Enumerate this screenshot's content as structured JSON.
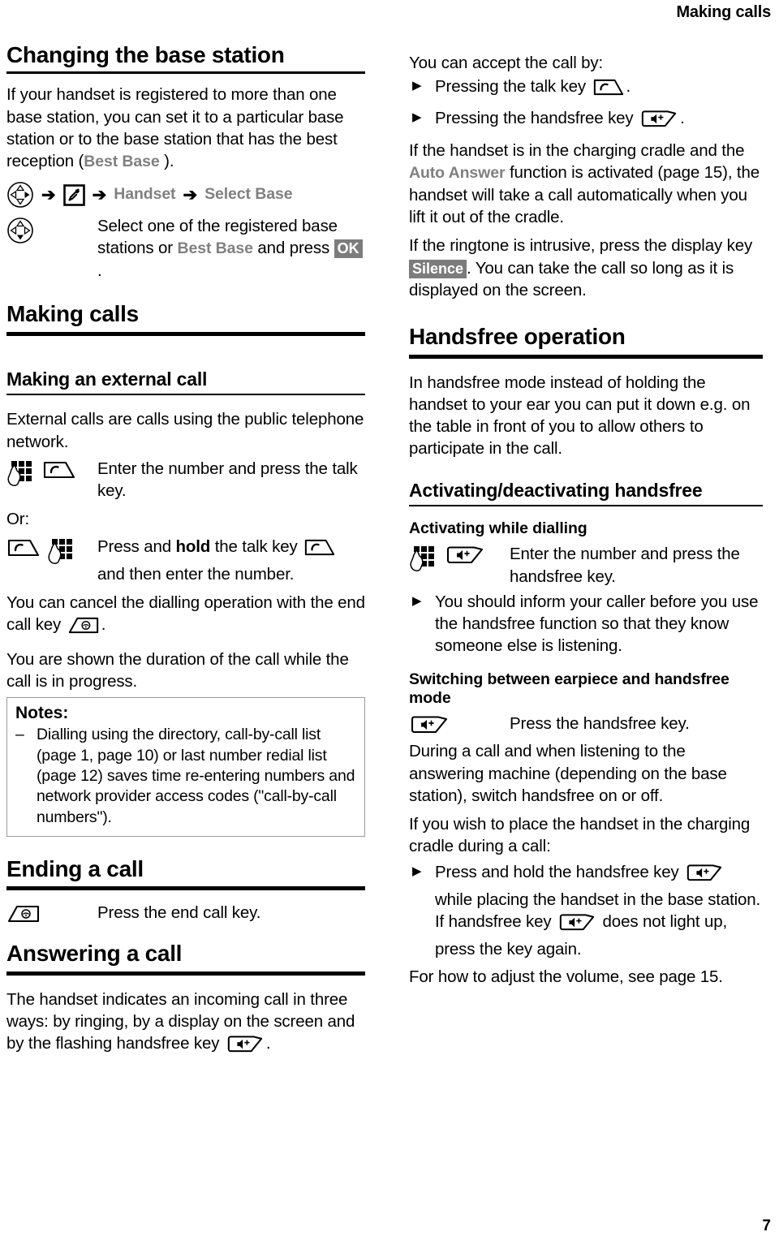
{
  "page": {
    "running_head": "Making calls",
    "folio": "7"
  },
  "left": {
    "h_changing_base": "Changing the base station",
    "p_intro_1": "If your handset is registered to more than one base station, you can set it to a particular base station or to the base station that has the best reception (",
    "p_intro_best_base": "Best Base",
    "p_intro_2": " ).",
    "menu_path": {
      "nav_icon": "navigation-key-right-icon",
      "arrow": "➔",
      "settings_icon": "wrench-menu-icon",
      "item_handset": "Handset",
      "item_select_base": "Select Base"
    },
    "select_step": {
      "nav_icon": "navigation-key-down-icon",
      "text_1": "Select one of the registered base stations or ",
      "term_best_base": "Best Base",
      "text_2": " and press ",
      "key_ok": "OK",
      "text_3": "."
    },
    "h_making_calls": "Making calls",
    "h_making_external": "Making an external call",
    "p_external": "External calls are calls using the public telephone network.",
    "proc_enter_number": {
      "icon_keypad": "keypad-hand-icon",
      "icon_talk": "talk-key-icon",
      "text": "Enter the number and press the talk key."
    },
    "or_label": "Or:",
    "proc_hold_talk": {
      "icon_talk": "talk-key-icon",
      "icon_keypad": "keypad-hand-icon",
      "text_1": "Press and ",
      "bold_hold": "hold",
      "text_2": " the talk key ",
      "icon_inline_talk": "talk-key-icon",
      "text_3": " and then enter the number."
    },
    "p_cancel_1": "You can cancel the dialling operation with the end call key ",
    "p_cancel_icon": "end-call-key-icon",
    "p_cancel_2": ".",
    "p_duration": "You are shown the duration of the call while the call is in progress.",
    "notes": {
      "title": "Notes:",
      "dash": "–",
      "items": [
        "Dialling using the directory, call-by-call list (page 1, page 10) or last number redial list (page 12) saves time re-entering numbers and network provider access codes (\"call-by-call numbers\")."
      ]
    },
    "h_ending_call": "Ending a call",
    "proc_end_call": {
      "icon_end": "end-call-key-icon",
      "text": "Press the end call key."
    },
    "h_answering_call": "Answering a call",
    "p_answering_1": "The handset indicates an incoming call in three ways: by ringing, by a display on the screen and by the flashing handsfree key ",
    "p_answering_icon": "handsfree-key-icon",
    "p_answering_2": "."
  },
  "right": {
    "p_accept": "You can accept the call by:",
    "bullets_accept": [
      {
        "mark": "▶",
        "text_1": "Pressing the talk key ",
        "icon": "talk-key-icon",
        "text_2": "."
      },
      {
        "mark": "▶",
        "text_1": "Pressing the handsfree key ",
        "icon": "handsfree-key-icon",
        "text_2": "."
      }
    ],
    "p_cradle_1": "If the handset is in the charging cradle and the ",
    "p_cradle_term": "Auto Answer",
    "p_cradle_2": " function is activated (page 15), the handset will take a call automatically when you lift it out of the cradle.",
    "p_ringtone_1": "If the ringtone is intrusive, press the display key ",
    "p_ringtone_key": "Silence",
    "p_ringtone_2": ". You can take the call so long as it is displayed on the screen.",
    "h_handsfree_operation": "Handsfree operation",
    "p_handsfree_mode": "In handsfree mode instead of holding the handset to your ear you can put it down e.g. on the table in front of you to allow others to participate in the call.",
    "h_activating_deactivating": "Activating/deactivating handsfree",
    "h_activating_dialling": "Activating while dialling",
    "proc_activating": {
      "icon_keypad": "keypad-hand-icon",
      "icon_handsfree": "handsfree-key-icon",
      "text": "Enter the number and press the handsfree key."
    },
    "bullet_inform": {
      "mark": "▶",
      "text": "You should inform your caller before you use the handsfree function so that they know someone else is listening."
    },
    "h_switching": "Switching between earpiece and handsfree mode",
    "proc_press_hf": {
      "icon_handsfree": "handsfree-key-icon",
      "text": "Press the handsfree key."
    },
    "p_during_call": "During a call and when listening to the answering machine (depending on the base station), switch handsfree on or off.",
    "p_place_cradle": "If you wish to place the handset in the charging cradle during a call:",
    "bullet_hold_hf": {
      "mark": "▶",
      "text_1": "Press and hold the handsfree key ",
      "icon_1": "handsfree-key-icon",
      "text_2": " while placing the handset in the base station. If handsfree key ",
      "icon_2": "handsfree-key-icon",
      "text_3": " does not light up, press the key again."
    },
    "p_volume": "For how to adjust the volume, see page 15."
  },
  "colors": {
    "menu_term": "#808080",
    "display_key_bg": "#7c7c7c",
    "display_key_fg": "#ffffff",
    "notes_border": "#9a9a9a",
    "text": "#000000"
  }
}
